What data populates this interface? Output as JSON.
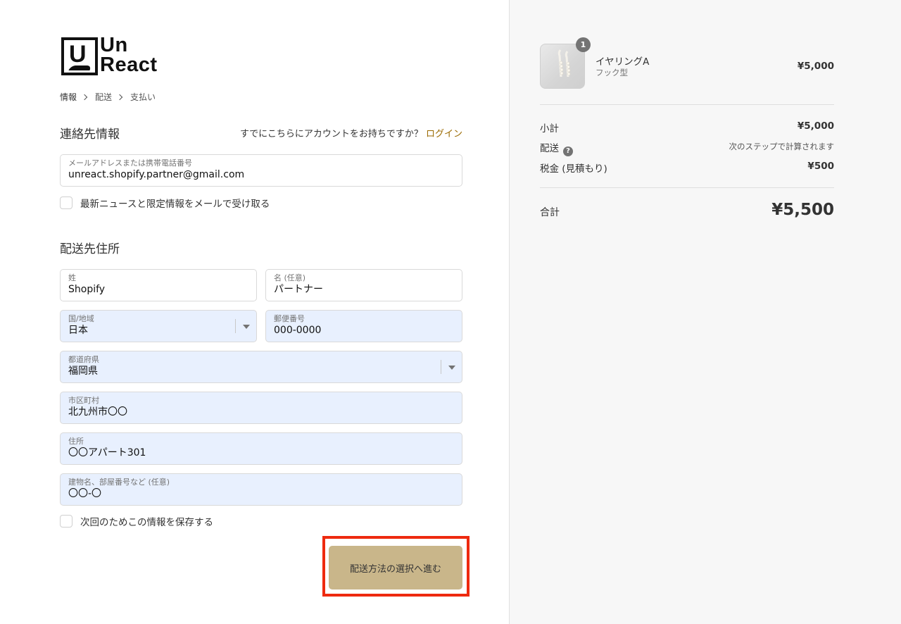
{
  "logo": {
    "line1": "Un",
    "line2": "React",
    "mark": "U"
  },
  "breadcrumb": [
    "情報",
    "配送",
    "支払い"
  ],
  "contact": {
    "title": "連絡先情報",
    "login_prompt": "すでにこちらにアカウントをお持ちですか？",
    "login_link": "ログイン",
    "email_label": "メールアドレスまたは携帯電話番号",
    "email_value": "unreact.shopify.partner@gmail.com",
    "newsletter_label": "最新ニュースと限定情報をメールで受け取る"
  },
  "shipping": {
    "title": "配送先住所",
    "last_name": {
      "label": "姓",
      "value": "Shopify"
    },
    "first_name": {
      "label": "名 (任意)",
      "value": "パートナー"
    },
    "country": {
      "label": "国/地域",
      "value": "日本"
    },
    "postal": {
      "label": "郵便番号",
      "value": "000-0000"
    },
    "prefecture": {
      "label": "都道府県",
      "value": "福岡県"
    },
    "city": {
      "label": "市区町村",
      "value": "北九州市〇〇"
    },
    "address": {
      "label": "住所",
      "value": "〇〇アパート301"
    },
    "building": {
      "label": "建物名、部屋番号など (任意)",
      "value": "〇〇-〇"
    },
    "save_label": "次回のためこの情報を保存する"
  },
  "cta": {
    "label": "配送方法の選択へ進む"
  },
  "summary": {
    "product": {
      "name": "イヤリングA",
      "variant": "フック型",
      "price": "¥5,000",
      "quantity": "1"
    },
    "subtotal_label": "小計",
    "subtotal_value": "¥5,000",
    "shipping_label": "配送",
    "shipping_value": "次のステップで計算されます",
    "tax_label": "税金 (見積もり)",
    "tax_value": "¥500",
    "total_label": "合計",
    "total_value": "¥5,500"
  },
  "colors": {
    "accent_button": "#c9b68a",
    "login_link": "#9a6a00",
    "highlight_outline": "#ee2a0f",
    "autofill": "#e8f0fe"
  }
}
